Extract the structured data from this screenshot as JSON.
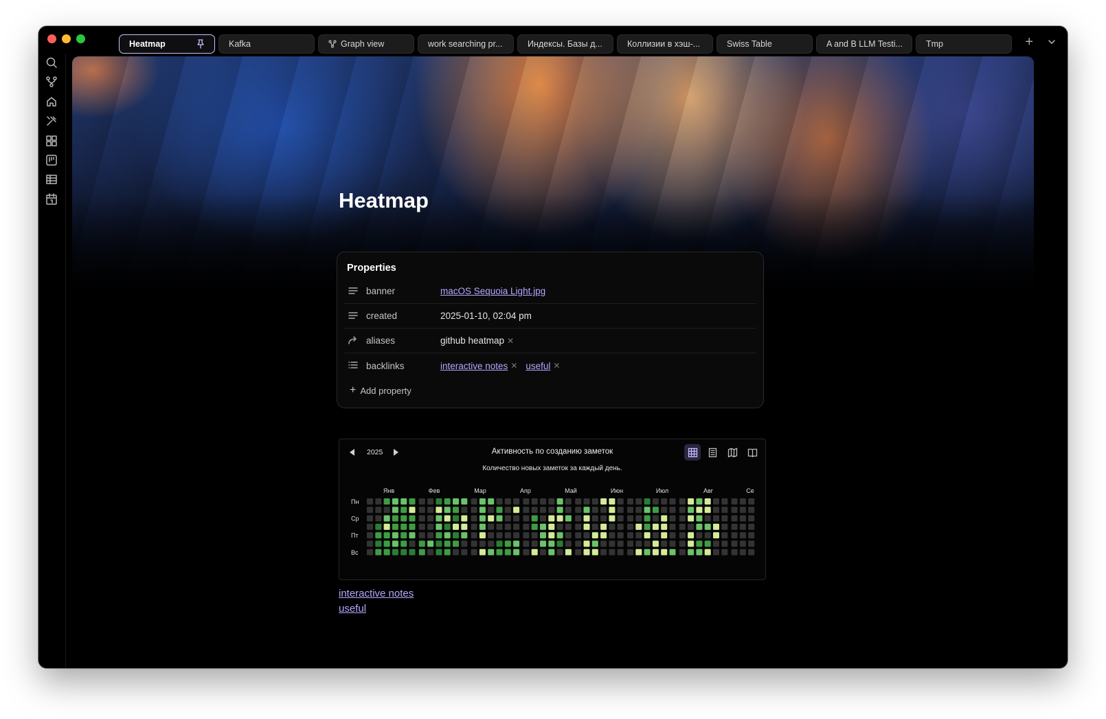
{
  "tabs": [
    {
      "label": "Heatmap",
      "active": true,
      "pinned": true
    },
    {
      "label": "Kafka"
    },
    {
      "label": "Graph view",
      "icon": "graph-icon"
    },
    {
      "label": "work searching pr..."
    },
    {
      "label": "Индексы. Базы д..."
    },
    {
      "label": "Коллизии в хэш-..."
    },
    {
      "label": "Swiss Table"
    },
    {
      "label": "A and B LLM Testi..."
    },
    {
      "label": "Tmp"
    }
  ],
  "ribbon_icons": [
    "search-icon",
    "git-branch-icon",
    "home-icon",
    "tools-icon",
    "dashboard-icon",
    "kanban-icon",
    "table-icon",
    "calendar-icon"
  ],
  "page": {
    "title": "Heatmap"
  },
  "properties": {
    "title": "Properties",
    "rows": [
      {
        "key": "banner",
        "icon": "text-icon",
        "value": "macOS Sequoia Light.jpg",
        "link": true
      },
      {
        "key": "created",
        "icon": "text-icon",
        "value": "2025-01-10, 02:04 pm"
      },
      {
        "key": "aliases",
        "icon": "arrow-icon",
        "values": [
          "github heatmap"
        ]
      },
      {
        "key": "backlinks",
        "icon": "list-icon",
        "values": [
          "interactive notes",
          "useful"
        ],
        "link": true
      }
    ],
    "add_label": "Add property"
  },
  "heatmap": {
    "year": "2025",
    "title": "Активность по созданию заметок",
    "subtitle": "Количество новых заметок за каждый день.",
    "months": [
      "Янв",
      "Фев",
      "Мар",
      "Апр",
      "Май",
      "Июн",
      "Июл",
      "Авг",
      "Се"
    ],
    "day_labels": [
      "Пн",
      "",
      "Ср",
      "",
      "Пт",
      "",
      "Вс"
    ],
    "colors": [
      "#333333",
      "#2a7d35",
      "#3f9c44",
      "#6bc26a",
      "#d5eb98"
    ],
    "levels": [
      [
        0,
        0,
        0,
        0,
        0,
        0,
        0
      ],
      [
        0,
        0,
        0,
        1,
        2,
        1,
        2
      ],
      [
        2,
        0,
        3,
        4,
        2,
        2,
        2
      ],
      [
        3,
        3,
        2,
        2,
        3,
        3,
        1
      ],
      [
        3,
        2,
        2,
        2,
        2,
        2,
        1
      ],
      [
        2,
        4,
        2,
        2,
        3,
        0,
        1
      ],
      [
        0,
        0,
        0,
        0,
        0,
        2,
        2
      ],
      [
        0,
        0,
        0,
        0,
        0,
        3,
        0
      ],
      [
        1,
        4,
        3,
        3,
        2,
        1,
        1
      ],
      [
        2,
        3,
        4,
        1,
        3,
        2,
        2
      ],
      [
        3,
        2,
        1,
        4,
        1,
        2,
        0
      ],
      [
        3,
        0,
        4,
        4,
        3,
        0,
        0
      ],
      [
        0,
        0,
        0,
        0,
        0,
        0,
        0
      ],
      [
        3,
        3,
        3,
        3,
        4,
        0,
        4
      ],
      [
        3,
        0,
        4,
        0,
        0,
        0,
        3
      ],
      [
        0,
        2,
        3,
        0,
        0,
        1,
        2
      ],
      [
        0,
        0,
        0,
        0,
        0,
        2,
        2
      ],
      [
        0,
        4,
        0,
        0,
        0,
        3,
        3
      ],
      [
        0,
        0,
        0,
        0,
        0,
        0,
        0
      ],
      [
        0,
        0,
        2,
        2,
        0,
        0,
        4
      ],
      [
        0,
        0,
        0,
        3,
        3,
        3,
        0
      ],
      [
        0,
        0,
        4,
        4,
        4,
        3,
        3
      ],
      [
        3,
        3,
        4,
        0,
        3,
        1,
        0
      ],
      [
        0,
        0,
        3,
        0,
        0,
        0,
        4
      ],
      [
        0,
        0,
        0,
        0,
        0,
        0,
        0
      ],
      [
        0,
        3,
        4,
        4,
        0,
        4,
        4
      ],
      [
        0,
        0,
        0,
        0,
        4,
        3,
        4
      ],
      [
        4,
        0,
        0,
        4,
        4,
        0,
        0
      ],
      [
        4,
        4,
        4,
        0,
        0,
        0,
        0
      ],
      [
        0,
        0,
        0,
        0,
        0,
        0,
        0
      ],
      [
        0,
        0,
        0,
        0,
        0,
        0,
        0
      ],
      [
        0,
        0,
        0,
        4,
        0,
        0,
        4
      ],
      [
        1,
        3,
        2,
        2,
        4,
        0,
        3
      ],
      [
        0,
        2,
        0,
        4,
        0,
        4,
        4
      ],
      [
        0,
        0,
        4,
        4,
        4,
        0,
        4
      ],
      [
        0,
        0,
        0,
        0,
        0,
        0,
        3
      ],
      [
        0,
        0,
        0,
        0,
        0,
        0,
        0
      ],
      [
        4,
        3,
        4,
        0,
        4,
        4,
        3
      ],
      [
        3,
        4,
        3,
        3,
        0,
        2,
        3
      ],
      [
        4,
        4,
        0,
        3,
        0,
        2,
        4
      ],
      [
        0,
        0,
        0,
        4,
        4,
        0,
        0
      ],
      [
        0,
        0,
        0,
        0,
        0,
        0,
        0
      ],
      [
        0,
        0,
        0,
        0,
        0,
        0,
        0
      ],
      [
        0,
        0,
        0,
        0,
        0,
        0,
        0
      ],
      [
        0,
        0,
        0,
        0,
        0,
        0,
        0
      ],
      [
        0,
        0,
        0,
        0,
        0,
        0,
        0
      ],
      [
        0,
        0,
        0,
        0,
        0,
        0,
        0
      ],
      [
        0,
        0,
        0,
        0,
        0,
        0,
        0
      ],
      [
        0,
        0,
        0,
        0,
        0,
        0,
        0
      ],
      [
        0,
        0,
        0,
        0,
        0,
        0,
        0
      ],
      [
        0,
        0,
        0,
        0,
        0,
        0,
        0
      ],
      [
        0,
        0,
        0,
        0,
        0,
        0,
        0
      ]
    ]
  },
  "backlinks": [
    "interactive notes",
    "useful"
  ]
}
